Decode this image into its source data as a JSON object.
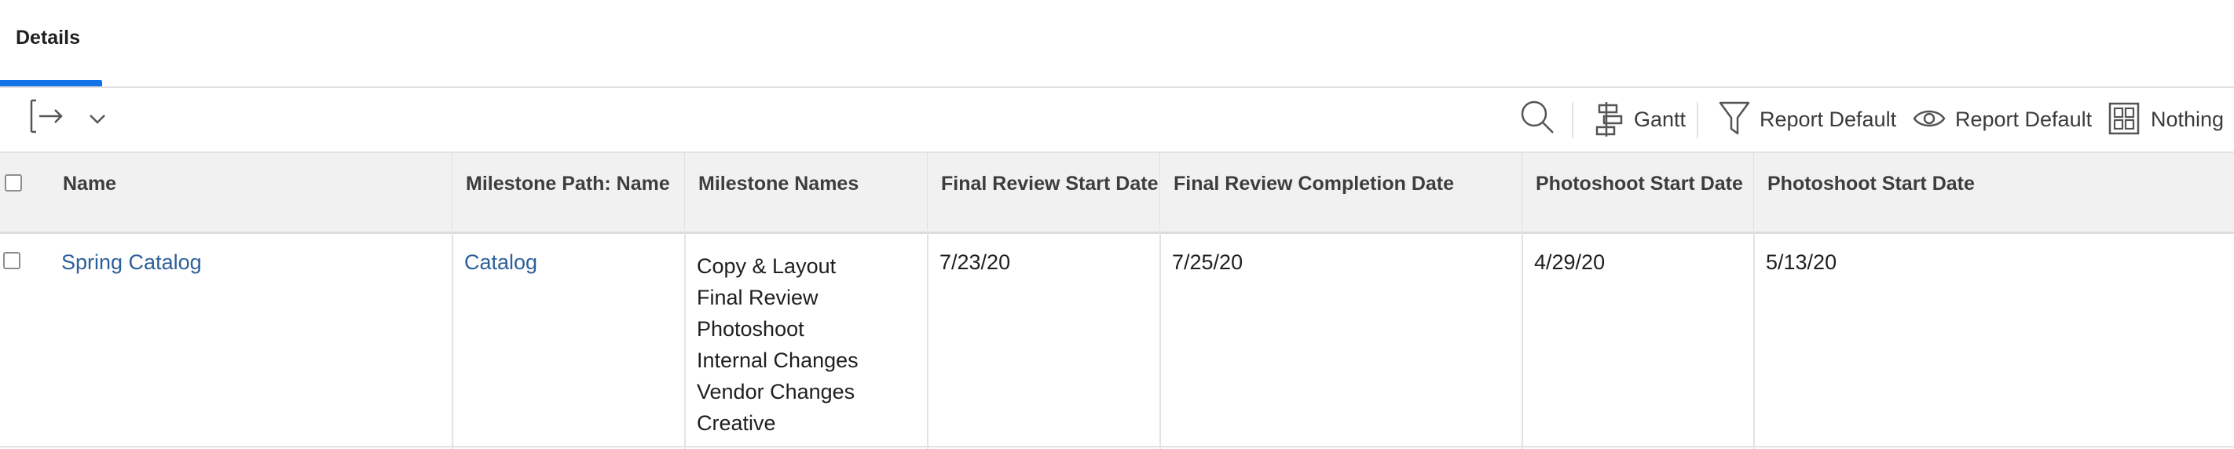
{
  "tabs": [
    {
      "label": "Details",
      "active": true
    }
  ],
  "toolbar": {
    "export_icon": "export-icon",
    "dropdown_icon": "chevron-down-icon",
    "search_icon": "search-icon",
    "gantt_label": "Gantt",
    "filter_label": "Report Default",
    "view_label": "Report Default",
    "groupby_label": "Nothing"
  },
  "table": {
    "headers": [
      "Name",
      "Milestone Path: Name",
      "Milestone Names",
      "Final Review Start Date",
      "Final Review Completion Date",
      "Photoshoot Start Date",
      "Photoshoot Start Date"
    ],
    "rows": [
      {
        "name": "Spring Catalog",
        "milestone_path": "Catalog",
        "milestone_names": [
          "Copy & Layout",
          "Final Review",
          "Photoshoot",
          "Internal Changes",
          "Vendor Changes",
          "Creative"
        ],
        "final_review_start": "7/23/20",
        "final_review_completion": "7/25/20",
        "photoshoot_start_1": "4/29/20",
        "photoshoot_start_2": "5/13/20"
      }
    ]
  },
  "colors": {
    "accent": "#1473e6",
    "link": "#2d5f9a",
    "header_bg": "#f1f1f1"
  }
}
